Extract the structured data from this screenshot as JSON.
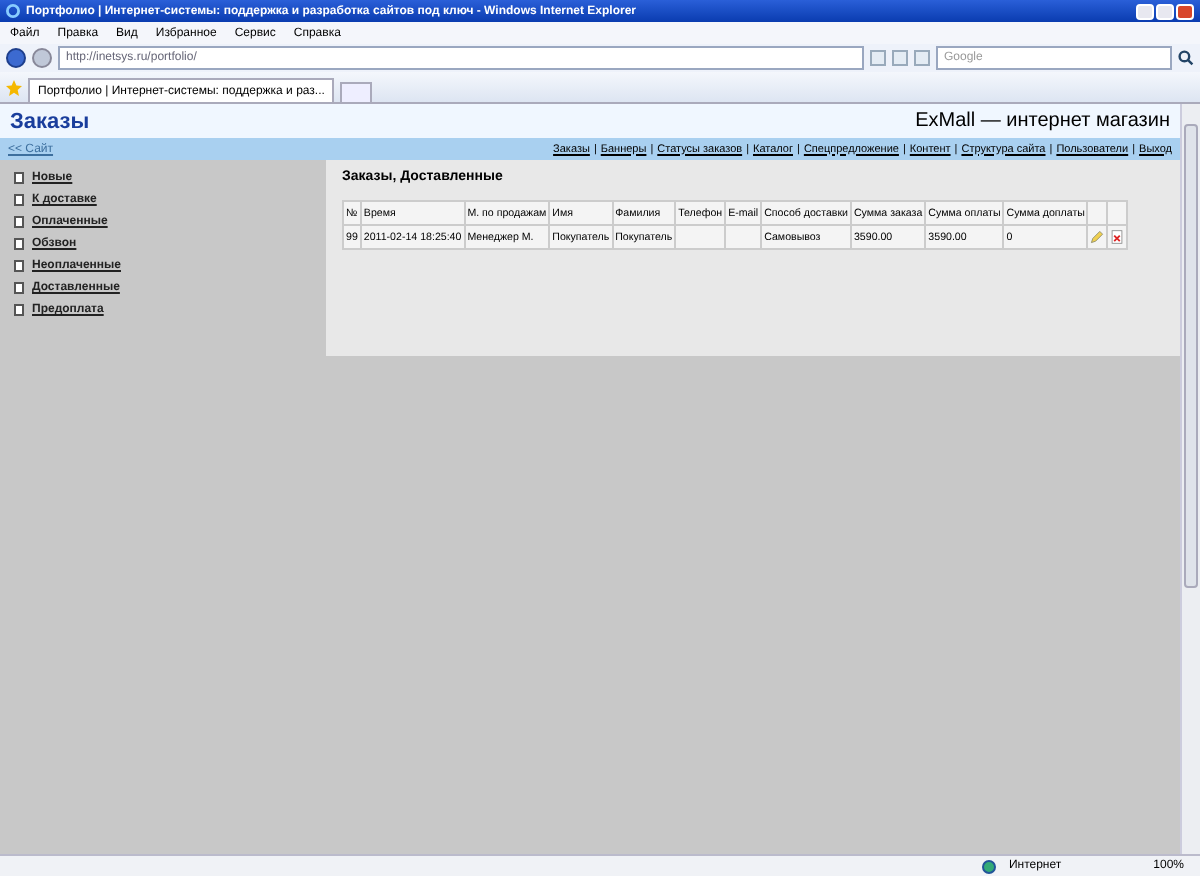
{
  "window": {
    "title": "Портфолио | Интернет-системы: поддержка и разработка сайтов под ключ - Windows Internet Explorer"
  },
  "menu": [
    "Файл",
    "Правка",
    "Вид",
    "Избранное",
    "Сервис",
    "Справка"
  ],
  "address": {
    "value": "http://inetsys.ru/portfolio/"
  },
  "search": {
    "placeholder": "Google"
  },
  "tabs": [
    {
      "label": "Портфолио | Интернет-системы: поддержка и раз...",
      "selected": true
    }
  ],
  "page": {
    "title": "Заказы",
    "site_name": "ExMall — интернет магазин",
    "back_link": "<< Сайт",
    "nav_separator": "|",
    "nav": [
      "Заказы",
      "Баннеры",
      "Статусы заказов",
      "Каталог",
      "Спецпредложение",
      "Контент",
      "Структура сайта",
      "Пользователи",
      "Выход"
    ],
    "sidebar": {
      "items": [
        "Новые",
        "К доставке",
        "Оплаченные",
        "Обзвон",
        "Неоплаченные",
        "Доставленные",
        "Предоплата"
      ]
    },
    "heading": "Заказы, Доставленные",
    "table": {
      "columns": [
        "№",
        "Время",
        "М. по продажам",
        "Имя",
        "Фамилия",
        "Телефон",
        "E-mail",
        "Способ доставки",
        "Сумма заказа",
        "Сумма оплаты",
        "Сумма доплаты"
      ],
      "rows": [
        [
          "99",
          "2011-02-14 18:25:40",
          "Менеджер М.",
          "Покупатель",
          "Покупатель",
          "",
          "",
          "Самовывоз",
          "3590.00",
          "3590.00",
          "0"
        ]
      ]
    }
  },
  "status_bar": {
    "zone": "Интернет",
    "zoom": "100%"
  }
}
